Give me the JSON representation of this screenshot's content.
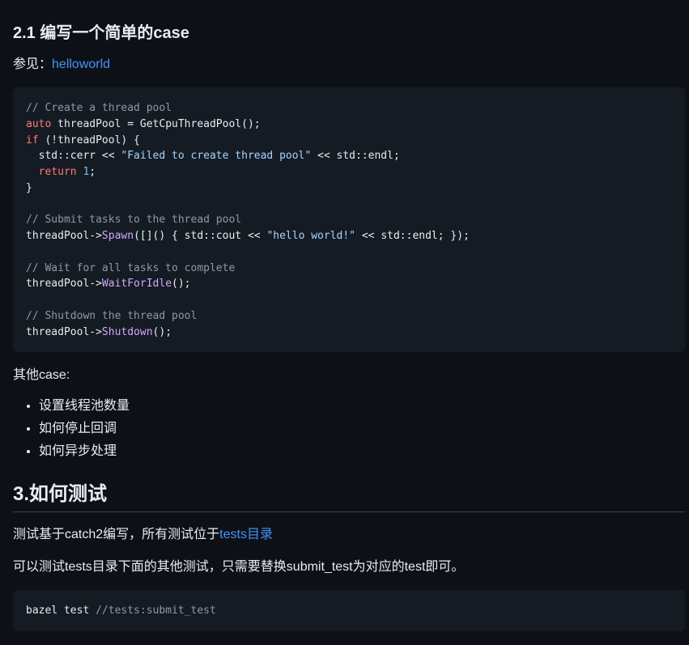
{
  "section_2_1": {
    "heading": "2.1 编写一个简单的case",
    "see_also_prefix": "参见：",
    "see_also_link": "helloworld",
    "code_lines": [
      [
        {
          "t": "// Create a thread pool",
          "c": "cm"
        }
      ],
      [
        {
          "t": "auto",
          "c": "kw"
        },
        {
          "t": " threadPool = GetCpuThreadPool();",
          "c": ""
        }
      ],
      [
        {
          "t": "if",
          "c": "kw"
        },
        {
          "t": " (!threadPool) {",
          "c": ""
        }
      ],
      [
        {
          "t": "  std::cerr << ",
          "c": ""
        },
        {
          "t": "\"Failed to create thread pool\"",
          "c": "st"
        },
        {
          "t": " << std::endl;",
          "c": ""
        }
      ],
      [
        {
          "t": "  ",
          "c": ""
        },
        {
          "t": "return",
          "c": "kw"
        },
        {
          "t": " ",
          "c": ""
        },
        {
          "t": "1",
          "c": "num"
        },
        {
          "t": ";",
          "c": ""
        }
      ],
      [
        {
          "t": "}",
          "c": ""
        }
      ],
      [
        {
          "t": "",
          "c": ""
        }
      ],
      [
        {
          "t": "// Submit tasks to the thread pool",
          "c": "cm"
        }
      ],
      [
        {
          "t": "threadPool->",
          "c": ""
        },
        {
          "t": "Spawn",
          "c": "fn"
        },
        {
          "t": "([]() { std::cout << ",
          "c": ""
        },
        {
          "t": "\"hello world!\"",
          "c": "st"
        },
        {
          "t": " << std::endl; });",
          "c": ""
        }
      ],
      [
        {
          "t": "",
          "c": ""
        }
      ],
      [
        {
          "t": "// Wait for all tasks to complete",
          "c": "cm"
        }
      ],
      [
        {
          "t": "threadPool->",
          "c": ""
        },
        {
          "t": "WaitForIdle",
          "c": "fn"
        },
        {
          "t": "();",
          "c": ""
        }
      ],
      [
        {
          "t": "",
          "c": ""
        }
      ],
      [
        {
          "t": "// Shutdown the thread pool",
          "c": "cm"
        }
      ],
      [
        {
          "t": "threadPool->",
          "c": ""
        },
        {
          "t": "Shutdown",
          "c": "fn"
        },
        {
          "t": "();",
          "c": ""
        }
      ]
    ],
    "other_cases_label": "其他case:",
    "other_cases": [
      "设置线程池数量",
      "如何停止回调",
      "如何异步处理"
    ]
  },
  "section_3": {
    "heading": "3.如何测试",
    "intro_prefix": "测试基于catch2编写，所有测试位于",
    "intro_link": "tests目录",
    "note": "可以测试tests目录下面的其他测试，只需要替换submit_test为对应的test即可。",
    "cmd_code": [
      [
        {
          "t": "bazel test ",
          "c": ""
        },
        {
          "t": "//tests:submit_test",
          "c": "cm"
        }
      ]
    ]
  },
  "colors": {
    "background": "#0d1117",
    "code_background": "#151b23",
    "link": "#4493f8",
    "keyword": "#ff7b72",
    "string": "#a5d6ff",
    "function": "#d2a8ff",
    "comment": "#9198a1"
  }
}
